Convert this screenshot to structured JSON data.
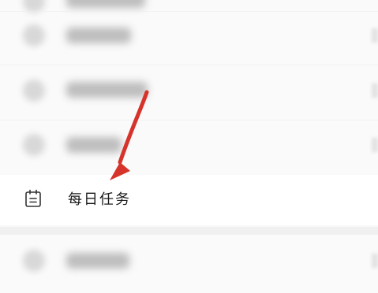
{
  "menu": {
    "highlighted_item": {
      "label": "每日任务",
      "icon": "calendar-icon"
    },
    "blurred_item_icons": [
      "blurred-icon",
      "blurred-icon",
      "blurred-icon",
      "blurred-icon"
    ]
  },
  "annotation": {
    "arrow_color": "#d6332b",
    "icon": "arrow-icon"
  }
}
